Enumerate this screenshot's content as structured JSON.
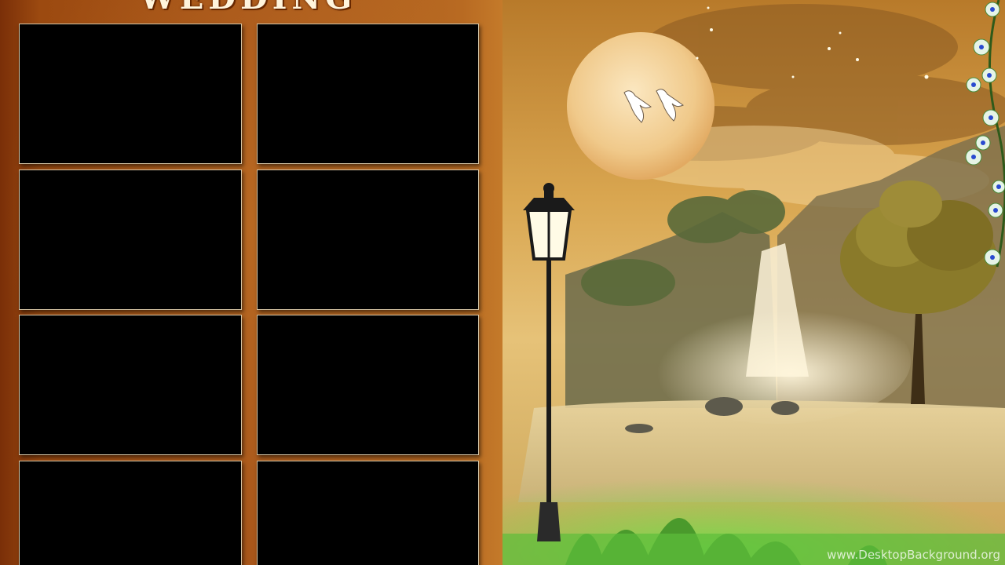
{
  "title": "WEDDING",
  "watermark": "www.DesktopBackground.org",
  "photo_frames": [
    {
      "id": "frame-1"
    },
    {
      "id": "frame-2"
    },
    {
      "id": "frame-3"
    },
    {
      "id": "frame-4"
    },
    {
      "id": "frame-5"
    },
    {
      "id": "frame-6"
    },
    {
      "id": "frame-7"
    },
    {
      "id": "frame-8"
    }
  ],
  "icons": [
    "moon-icon",
    "swan-icon",
    "lamp-post-icon",
    "waterfall-icon",
    "tree-icon",
    "flower-vine-icon",
    "sparkle-icon"
  ],
  "colors": {
    "frame_fill": "#000000",
    "frame_border": "#d9c8a8",
    "panel_brown": "#9c4a10",
    "sky_gold": "#d6a44e",
    "grass_green": "#5fb83a"
  }
}
